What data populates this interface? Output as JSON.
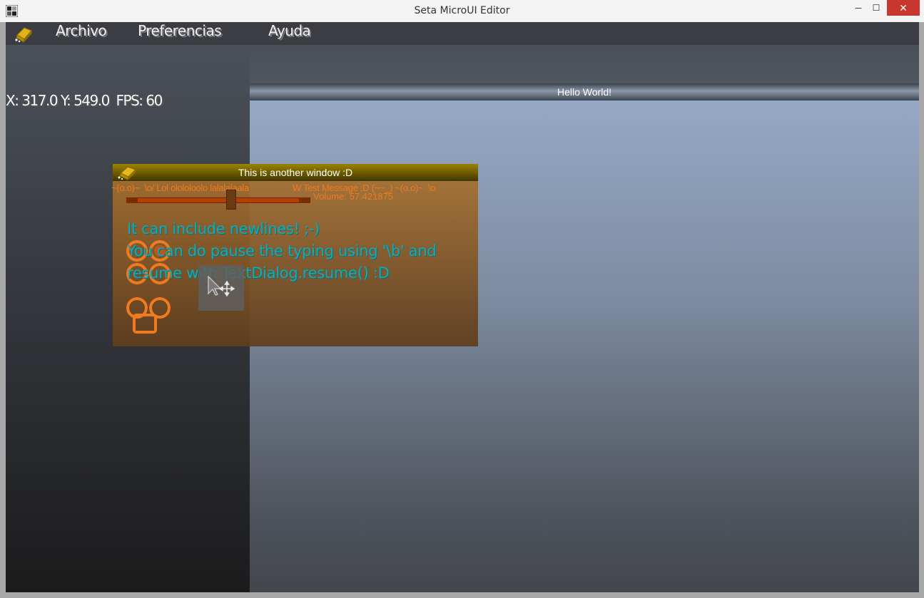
{
  "window": {
    "title": "Seta MicroUI Editor",
    "controls": {
      "minimize": "─",
      "maximize": "☐",
      "close": "✕"
    }
  },
  "menubar": {
    "items": [
      {
        "label": "Archivo"
      },
      {
        "label": "Preferencias"
      },
      {
        "label": "Ayuda"
      }
    ]
  },
  "status": {
    "coords": "X: 317.0 Y: 549.0  FPS: 60"
  },
  "hello_window": {
    "title": "Hello World!"
  },
  "another_window": {
    "title": "This is another window :D",
    "marquee_left": "~(o.o)~  \\o/ Lol olololoolo lalalalaala",
    "marquee_right": "W Test Message :D (~~_) ~(o.o)~  \\o",
    "volume_label": "Volume: 57.421875",
    "volume": 57.421875,
    "dialog_lines": [
      "It can include newlines! ;-)",
      "You can do pause the typing using '\\b' and",
      "resume with TextDialog.resume() :D"
    ]
  },
  "colors": {
    "menubar": "#3b3d43",
    "hello_titlebar": "#8c98a8",
    "another_titlebar": "#9c8300",
    "accent_orange": "#ef7a21",
    "dialog_text": "#1aa7b0",
    "close_button": "#c7372f"
  },
  "icons": {
    "app": "app-icon",
    "menu_logo": "gold-ingot-icon",
    "window_logo": "gold-ingot-icon",
    "cursor": "move-cursor-icon"
  }
}
